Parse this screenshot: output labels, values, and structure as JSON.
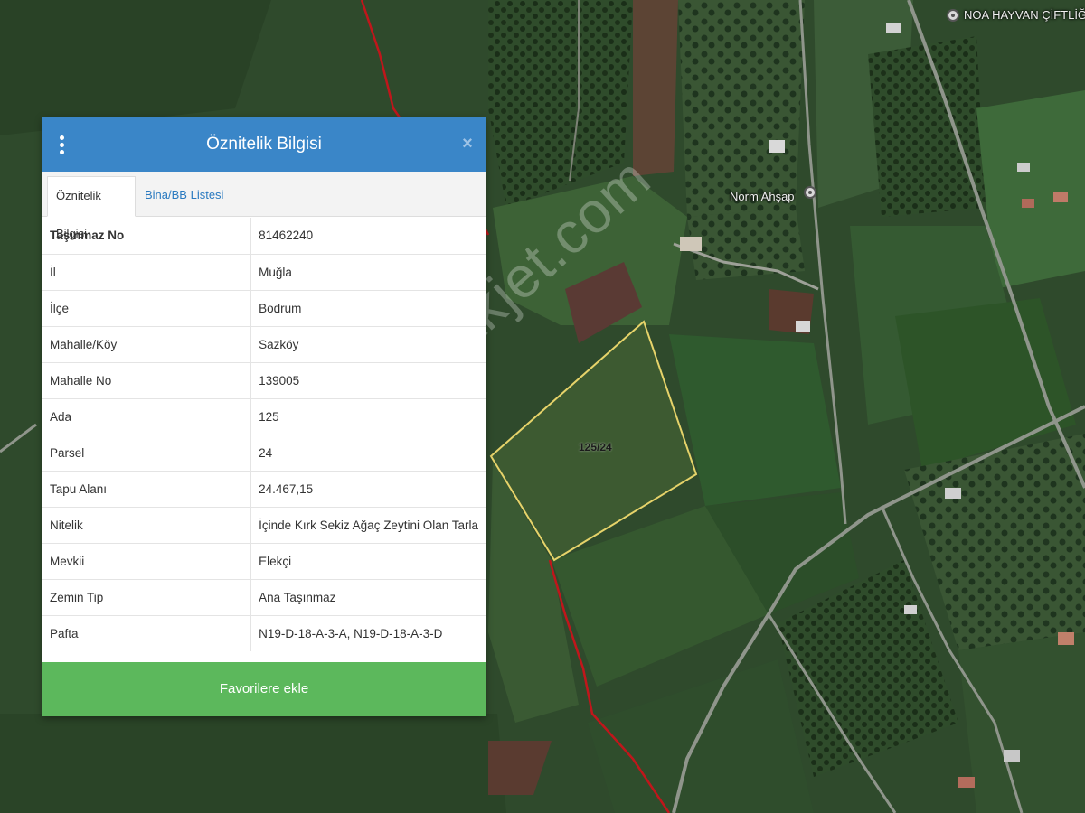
{
  "panel": {
    "title": "Öznitelik Bilgisi",
    "tabs": [
      {
        "label": "Öznitelik Bilgisi",
        "active": true
      },
      {
        "label": "Bina/BB Listesi",
        "active": false
      }
    ],
    "rows": [
      {
        "key": "Taşınmaz No",
        "value": "81462240"
      },
      {
        "key": "İl",
        "value": "Muğla"
      },
      {
        "key": "İlçe",
        "value": "Bodrum"
      },
      {
        "key": "Mahalle/Köy",
        "value": "Sazköy"
      },
      {
        "key": "Mahalle No",
        "value": "139005"
      },
      {
        "key": "Ada",
        "value": "125"
      },
      {
        "key": "Parsel",
        "value": "24"
      },
      {
        "key": "Tapu Alanı",
        "value": "24.467,15"
      },
      {
        "key": "Nitelik",
        "value": "İçinde Kırk Sekiz Ağaç Zeytini Olan Tarla"
      },
      {
        "key": "Mevkii",
        "value": "Elekçi"
      },
      {
        "key": "Zemin Tip",
        "value": "Ana Taşınmaz"
      },
      {
        "key": "Pafta",
        "value": "N19-D-18-A-3-A, N19-D-18-A-3-D"
      }
    ],
    "favorite_button": "Favorilere ekle"
  },
  "map": {
    "parcel_label": "125/24",
    "place_labels": [
      "NOA HAYVAN ÇİFTLİĞİ",
      "Norm Ahşap"
    ],
    "watermark": "emlakjet.com",
    "colors": {
      "parcel_outline": "#e6d36a",
      "boundary_line": "#c0161b",
      "header": "#3a86c8",
      "button": "#5cb85c",
      "tab_link": "#2a7ac0"
    }
  }
}
